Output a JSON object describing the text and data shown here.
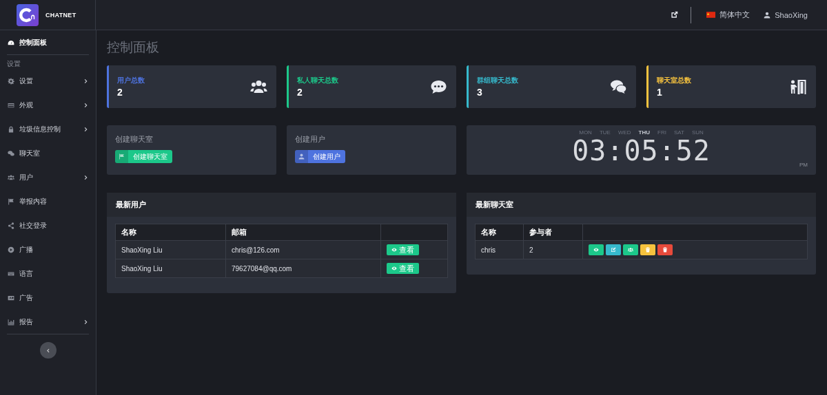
{
  "brand": {
    "name": "CHATNET"
  },
  "topbar": {
    "language": "简体中文",
    "user": "ShaoXing"
  },
  "sidebar": {
    "items": [
      {
        "kind": "link",
        "label": "控制面板",
        "selected": true,
        "has_submenu": false
      },
      {
        "kind": "section",
        "label": "设置"
      },
      {
        "kind": "link",
        "label": "设置",
        "selected": false,
        "has_submenu": true
      },
      {
        "kind": "link",
        "label": "外观",
        "selected": false,
        "has_submenu": true
      },
      {
        "kind": "link",
        "label": "垃圾信息控制",
        "selected": false,
        "has_submenu": true
      },
      {
        "kind": "link",
        "label": "聊天室",
        "selected": false,
        "has_submenu": false
      },
      {
        "kind": "link",
        "label": "用户",
        "selected": false,
        "has_submenu": true
      },
      {
        "kind": "link",
        "label": "举报内容",
        "selected": false,
        "has_submenu": false
      },
      {
        "kind": "link",
        "label": "社交登录",
        "selected": false,
        "has_submenu": false
      },
      {
        "kind": "link",
        "label": "广播",
        "selected": false,
        "has_submenu": false
      },
      {
        "kind": "link",
        "label": "语言",
        "selected": false,
        "has_submenu": false
      },
      {
        "kind": "link",
        "label": "广告",
        "selected": false,
        "has_submenu": false
      },
      {
        "kind": "link",
        "label": "报告",
        "selected": false,
        "has_submenu": true
      }
    ]
  },
  "page_title": "控制面板",
  "stats": [
    {
      "label": "用户总数",
      "value": "2",
      "color": "#4e73df"
    },
    {
      "label": "私人聊天总数",
      "value": "2",
      "color": "#1cc88a"
    },
    {
      "label": "群组聊天总数",
      "value": "3",
      "color": "#36b9cc"
    },
    {
      "label": "聊天室总数",
      "value": "1",
      "color": "#f6c23e"
    }
  ],
  "actions": [
    {
      "title": "创建聊天室",
      "button": "创建聊天室",
      "color": "#1cc88a"
    },
    {
      "title": "创建用户",
      "button": "创建用户",
      "color": "#4e73df"
    }
  ],
  "clock": {
    "days": [
      {
        "label": "MON",
        "selected": false
      },
      {
        "label": "TUE",
        "selected": false
      },
      {
        "label": "WED",
        "selected": false
      },
      {
        "label": "THU",
        "selected": true
      },
      {
        "label": "FRI",
        "selected": false
      },
      {
        "label": "SAT",
        "selected": false
      },
      {
        "label": "SUN",
        "selected": false
      }
    ],
    "time": "03:05:52",
    "meridiem": "PM"
  },
  "recent_users": {
    "title": "最新用户",
    "columns": [
      "名称",
      "邮箱"
    ],
    "rows": [
      {
        "cells": [
          "ShaoXing Liu",
          "chris@126.com"
        ],
        "actions": [
          {
            "kind": "view",
            "label": "查看",
            "color": "#1cc88a"
          }
        ]
      },
      {
        "cells": [
          "ShaoXing Liu",
          "79627084@qq.com"
        ],
        "actions": [
          {
            "kind": "view",
            "label": "查看",
            "color": "#1cc88a"
          }
        ]
      }
    ]
  },
  "recent_rooms": {
    "title": "最新聊天室",
    "columns": [
      "名称",
      "参与者"
    ],
    "rows": [
      {
        "cells": [
          "chris",
          "2"
        ],
        "actions": [
          {
            "kind": "view",
            "color": "#1cc88a"
          },
          {
            "kind": "edit",
            "color": "#36b9cc"
          },
          {
            "kind": "members",
            "color": "#1cc88a"
          },
          {
            "kind": "clear",
            "color": "#f6c23e"
          },
          {
            "kind": "delete",
            "color": "#e74a3b"
          }
        ]
      }
    ]
  }
}
